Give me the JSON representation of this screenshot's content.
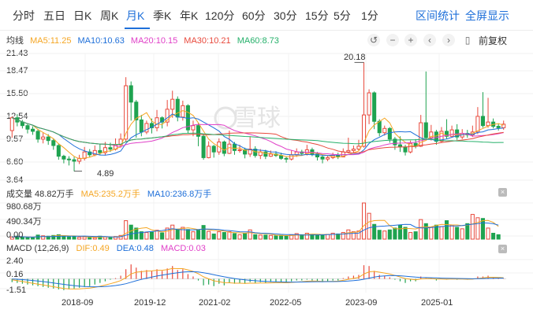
{
  "tabs": [
    "分时",
    "五日",
    "日K",
    "周K",
    "月K",
    "季K",
    "年K",
    "120分",
    "60分",
    "30分",
    "15分",
    "5分",
    "1分"
  ],
  "active_tab": "月K",
  "right_actions": {
    "interval_stats": "区间统计",
    "fullscreen": "全屏显示"
  },
  "ma_legend": {
    "label": "均线",
    "items": [
      {
        "text": "MA5:11.25",
        "color": "#f5a623"
      },
      {
        "text": "MA10:10.63",
        "color": "#1e6fd9"
      },
      {
        "text": "MA20:10.15",
        "color": "#e040c8"
      },
      {
        "text": "MA30:10.21",
        "color": "#e8493c"
      },
      {
        "text": "MA60:8.73",
        "color": "#25b06a"
      }
    ]
  },
  "toolbar": {
    "icons": [
      "history-icon",
      "zoom-out-icon",
      "zoom-in-icon",
      "prev-icon",
      "next-icon",
      "doc-icon"
    ],
    "adjust_label": "前复权"
  },
  "price_axis": [
    "21.43",
    "18.47",
    "15.50",
    "12.54",
    "9.57",
    "6.60",
    "3.64"
  ],
  "price_annotations": {
    "high": "20.18",
    "low": "4.89"
  },
  "watermark": "雪球",
  "volume": {
    "title": "成交量 48.82万手",
    "ma5": "MA5:235.2万手",
    "ma10": "MA10:236.8万手",
    "axis": [
      "980.68万",
      "490.34万",
      "0.00"
    ]
  },
  "macd": {
    "title": "MACD (12,26,9)",
    "dif": "DIF:0.49",
    "dea": "DEA:0.48",
    "macd": "MACD:0.03",
    "axis": [
      "2.40",
      "0.16",
      "-1.51"
    ]
  },
  "dates": [
    "2018-09",
    "2019-12",
    "2021-02",
    "2022-05",
    "2023-09",
    "2025-01"
  ],
  "colors": {
    "up": "#e8493c",
    "down": "#1fa350",
    "accent": "#1e6fd9"
  },
  "chart_data": {
    "type": "candlestick",
    "series": [
      {
        "name": "price",
        "values": [
          [
            10.6,
            12.4,
            12.6,
            9.6
          ],
          [
            12.4,
            11.8,
            12.9,
            11.2
          ],
          [
            11.8,
            11.3,
            12.1,
            10.9
          ],
          [
            11.3,
            10.8,
            11.6,
            10.2
          ],
          [
            10.8,
            10.5,
            11.2,
            10.0
          ],
          [
            10.5,
            9.4,
            10.8,
            8.9
          ],
          [
            9.4,
            9.7,
            10.3,
            8.8
          ],
          [
            9.7,
            9.2,
            10.1,
            8.6
          ],
          [
            9.2,
            8.5,
            9.5,
            7.9
          ],
          [
            8.5,
            7.0,
            8.8,
            6.5
          ],
          [
            7.0,
            6.6,
            7.2,
            6.0
          ],
          [
            6.6,
            6.5,
            7.0,
            5.7
          ],
          [
            6.5,
            6.3,
            6.9,
            4.89
          ],
          [
            6.3,
            6.7,
            7.2,
            5.9
          ],
          [
            6.7,
            7.6,
            8.3,
            6.4
          ],
          [
            7.6,
            7.2,
            8.0,
            6.9
          ],
          [
            7.2,
            7.8,
            8.5,
            7.0
          ],
          [
            7.8,
            7.5,
            8.7,
            7.2
          ],
          [
            7.5,
            8.2,
            9.0,
            7.1
          ],
          [
            8.2,
            8.0,
            8.9,
            7.6
          ],
          [
            8.0,
            8.6,
            9.5,
            7.8
          ],
          [
            8.6,
            9.4,
            10.2,
            8.2
          ],
          [
            9.4,
            16.9,
            18.1,
            9.0
          ],
          [
            16.9,
            14.6,
            17.5,
            12.0
          ],
          [
            14.6,
            12.1,
            14.9,
            9.6
          ],
          [
            12.1,
            10.4,
            12.8,
            9.8
          ],
          [
            10.4,
            11.6,
            12.0,
            10.1
          ],
          [
            11.6,
            11.0,
            12.3,
            10.2
          ],
          [
            11.0,
            12.4,
            13.5,
            10.5
          ],
          [
            12.4,
            11.8,
            12.6,
            10.9
          ],
          [
            11.8,
            13.6,
            14.9,
            11.2
          ],
          [
            13.6,
            15.0,
            16.2,
            12.4
          ],
          [
            15.0,
            12.5,
            15.4,
            11.9
          ],
          [
            12.5,
            14.1,
            14.8,
            12.0
          ],
          [
            14.1,
            10.7,
            14.3,
            10.2
          ],
          [
            10.7,
            11.3,
            12.0,
            9.8
          ],
          [
            11.3,
            9.8,
            11.7,
            8.4
          ],
          [
            9.8,
            6.8,
            10.1,
            6.5
          ],
          [
            6.8,
            8.4,
            9.1,
            6.7
          ],
          [
            8.4,
            7.6,
            8.6,
            6.8
          ],
          [
            7.6,
            9.0,
            9.5,
            7.2
          ],
          [
            9.0,
            7.4,
            9.2,
            7.0
          ],
          [
            7.4,
            8.7,
            10.6,
            7.3
          ],
          [
            8.7,
            7.8,
            9.0,
            7.2
          ],
          [
            7.8,
            7.9,
            8.6,
            7.5
          ],
          [
            7.9,
            7.3,
            8.2,
            6.7
          ],
          [
            7.3,
            8.0,
            9.8,
            6.9
          ],
          [
            8.0,
            7.1,
            8.4,
            6.8
          ],
          [
            7.1,
            7.6,
            8.0,
            6.6
          ],
          [
            7.6,
            7.0,
            7.9,
            6.6
          ],
          [
            7.0,
            7.3,
            7.8,
            6.9
          ],
          [
            7.3,
            7.1,
            7.7,
            6.9
          ],
          [
            7.1,
            6.7,
            7.5,
            6.5
          ],
          [
            6.7,
            6.6,
            6.9,
            6.1
          ],
          [
            6.6,
            7.2,
            7.8,
            6.4
          ],
          [
            7.2,
            7.6,
            8.1,
            6.9
          ],
          [
            7.6,
            7.4,
            7.9,
            7.1
          ],
          [
            7.4,
            7.9,
            8.6,
            7.1
          ],
          [
            7.9,
            7.3,
            8.2,
            7.0
          ],
          [
            7.3,
            6.9,
            7.6,
            6.4
          ],
          [
            6.9,
            6.6,
            7.1,
            6.0
          ],
          [
            6.6,
            6.8,
            7.1,
            6.3
          ],
          [
            6.8,
            7.1,
            7.5,
            6.6
          ],
          [
            7.1,
            6.9,
            7.5,
            6.6
          ],
          [
            6.9,
            7.6,
            8.1,
            6.9
          ],
          [
            7.6,
            7.8,
            9.6,
            7.4
          ],
          [
            7.8,
            8.0,
            8.5,
            7.5
          ],
          [
            8.0,
            8.4,
            9.3,
            7.8
          ],
          [
            8.4,
            12.8,
            20.18,
            8.2
          ],
          [
            12.8,
            15.9,
            16.4,
            11.5
          ],
          [
            15.9,
            11.9,
            16.1,
            10.8
          ],
          [
            11.9,
            10.3,
            12.2,
            9.8
          ],
          [
            10.3,
            10.9,
            11.3,
            9.9
          ],
          [
            10.9,
            9.4,
            11.1,
            8.9
          ],
          [
            9.4,
            8.6,
            9.7,
            7.9
          ],
          [
            8.6,
            8.3,
            9.8,
            7.6
          ],
          [
            8.3,
            7.6,
            8.6,
            7.1
          ],
          [
            7.6,
            8.8,
            9.2,
            7.4
          ],
          [
            8.8,
            8.4,
            9.4,
            8.1
          ],
          [
            8.4,
            11.7,
            12.8,
            8.3
          ],
          [
            11.7,
            9.6,
            18.9,
            9.4
          ],
          [
            9.6,
            10.4,
            11.4,
            9.2
          ],
          [
            10.4,
            9.1,
            10.7,
            8.6
          ],
          [
            9.1,
            10.5,
            11.1,
            8.9
          ],
          [
            10.5,
            9.8,
            12.2,
            9.4
          ],
          [
            9.8,
            10.7,
            11.3,
            9.6
          ],
          [
            10.7,
            9.7,
            11.5,
            9.3
          ],
          [
            9.7,
            10.2,
            10.8,
            9.4
          ],
          [
            10.2,
            10.0,
            10.7,
            9.6
          ],
          [
            10.0,
            10.4,
            11.3,
            9.7
          ],
          [
            10.4,
            12.6,
            13.9,
            10.1
          ],
          [
            12.6,
            11.3,
            16.0,
            11.0
          ],
          [
            11.3,
            11.8,
            15.2,
            11.0
          ],
          [
            11.8,
            11.2,
            12.3,
            10.9
          ],
          [
            11.2,
            11.0,
            11.6,
            10.6
          ],
          [
            11.0,
            11.5,
            12.0,
            10.7
          ]
        ]
      }
    ],
    "ylim": [
      3.64,
      21.43
    ],
    "volume_values": [
      60,
      80,
      50,
      45,
      40,
      110,
      90,
      80,
      100,
      120,
      90,
      60,
      70,
      50,
      60,
      50,
      40,
      80,
      60,
      60,
      70,
      100,
      500,
      380,
      300,
      200,
      180,
      190,
      240,
      170,
      300,
      380,
      270,
      320,
      260,
      200,
      240,
      370,
      210,
      140,
      200,
      180,
      200,
      150,
      120,
      160,
      250,
      120,
      110,
      110,
      100,
      90,
      100,
      80,
      120,
      150,
      120,
      160,
      130,
      110,
      110,
      130,
      160,
      140,
      180,
      250,
      200,
      220,
      980,
      700,
      400,
      240,
      220,
      250,
      300,
      380,
      320,
      180,
      200,
      530,
      420,
      330,
      380,
      340,
      500,
      380,
      320,
      280,
      420,
      670,
      580,
      560,
      300,
      160,
      120
    ],
    "volume_ylim": [
      0,
      980.68
    ],
    "macd_values": [
      -0.4,
      -0.5,
      -0.6,
      -0.7,
      -0.8,
      -0.9,
      -1.0,
      -1.1,
      -1.2,
      -1.3,
      -1.4,
      -1.3,
      -1.2,
      -1.1,
      -1.0,
      -0.9,
      -0.7,
      -0.5,
      -0.3,
      -0.1,
      0.1,
      0.4,
      1.2,
      1.8,
      1.4,
      1.0,
      1.1,
      1.0,
      1.2,
      1.0,
      1.3,
      1.6,
      1.1,
      1.2,
      0.6,
      0.3,
      -0.2,
      -0.8,
      -0.7,
      -0.9,
      -0.6,
      -0.8,
      -0.5,
      -0.6,
      -0.5,
      -0.6,
      -0.4,
      -0.5,
      -0.4,
      -0.5,
      -0.4,
      -0.4,
      -0.4,
      -0.5,
      -0.3,
      -0.2,
      -0.2,
      -0.1,
      -0.2,
      -0.3,
      -0.4,
      -0.3,
      -0.2,
      -0.2,
      0.1,
      0.3,
      0.4,
      0.5,
      1.7,
      1.6,
      1.0,
      0.5,
      0.4,
      0.2,
      -0.1,
      -0.3,
      -0.5,
      -0.3,
      -0.3,
      0.3,
      0.1,
      0.1,
      -0.2,
      0.0,
      -0.1,
      0.1,
      -0.1,
      0.0,
      -0.1,
      0.0,
      0.3,
      0.3,
      0.4,
      0.2,
      0.1,
      0.03
    ],
    "macd_ylim": [
      -1.51,
      2.4
    ]
  }
}
